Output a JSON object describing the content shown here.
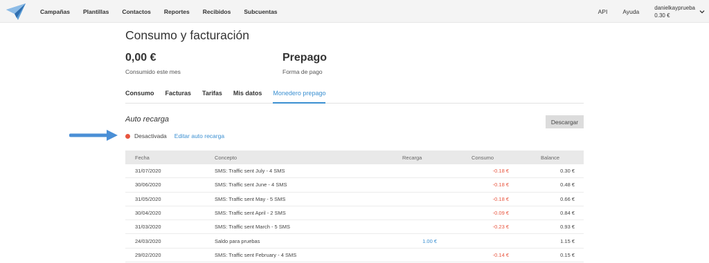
{
  "nav": {
    "items": [
      "Campañas",
      "Plantillas",
      "Contactos",
      "Reportes",
      "Recibidos",
      "Subcuentas"
    ],
    "api": "API",
    "help": "Ayuda",
    "account_name": "danielkayprueba",
    "account_balance": "0.30 €"
  },
  "page": {
    "title": "Consumo y facturación",
    "consumed_value": "0,00 €",
    "consumed_label": "Consumido este mes",
    "payment_value": "Prepago",
    "payment_label": "Forma de pago"
  },
  "tabs": [
    "Consumo",
    "Facturas",
    "Tarifas",
    "Mis datos",
    "Monedero prepago"
  ],
  "active_tab": "Monedero prepago",
  "auto_recharge": {
    "title": "Auto recarga",
    "status": "Desactivada",
    "status_color": "#e8553f",
    "edit_link": "Editar auto recarga",
    "download_button": "Descargar"
  },
  "table": {
    "headers": {
      "fecha": "Fecha",
      "concepto": "Concepto",
      "recarga": "Recarga",
      "consumo": "Consumo",
      "balance": "Balance"
    },
    "rows": [
      {
        "fecha": "31/07/2020",
        "concepto": "SMS: Traffic sent July - 4 SMS",
        "recarga": "",
        "consumo": "-0.18 €",
        "balance": "0.30 €"
      },
      {
        "fecha": "30/06/2020",
        "concepto": "SMS: Traffic sent June - 4 SMS",
        "recarga": "",
        "consumo": "-0.18 €",
        "balance": "0.48 €"
      },
      {
        "fecha": "31/05/2020",
        "concepto": "SMS: Traffic sent May - 5 SMS",
        "recarga": "",
        "consumo": "-0.18 €",
        "balance": "0.66 €"
      },
      {
        "fecha": "30/04/2020",
        "concepto": "SMS: Traffic sent April - 2 SMS",
        "recarga": "",
        "consumo": "-0.09 €",
        "balance": "0.84 €"
      },
      {
        "fecha": "31/03/2020",
        "concepto": "SMS: Traffic sent March - 5 SMS",
        "recarga": "",
        "consumo": "-0.23 €",
        "balance": "0.93 €"
      },
      {
        "fecha": "24/03/2020",
        "concepto": "Saldo para pruebas",
        "recarga": "1.00 €",
        "consumo": "",
        "balance": "1.15 €"
      },
      {
        "fecha": "29/02/2020",
        "concepto": "SMS: Traffic sent February - 4 SMS",
        "recarga": "",
        "consumo": "-0.14 €",
        "balance": "0.15 €"
      }
    ]
  },
  "colors": {
    "accent": "#3a8fd1",
    "negative": "#e8553f",
    "annotation_arrow": "#4a8fd6"
  }
}
